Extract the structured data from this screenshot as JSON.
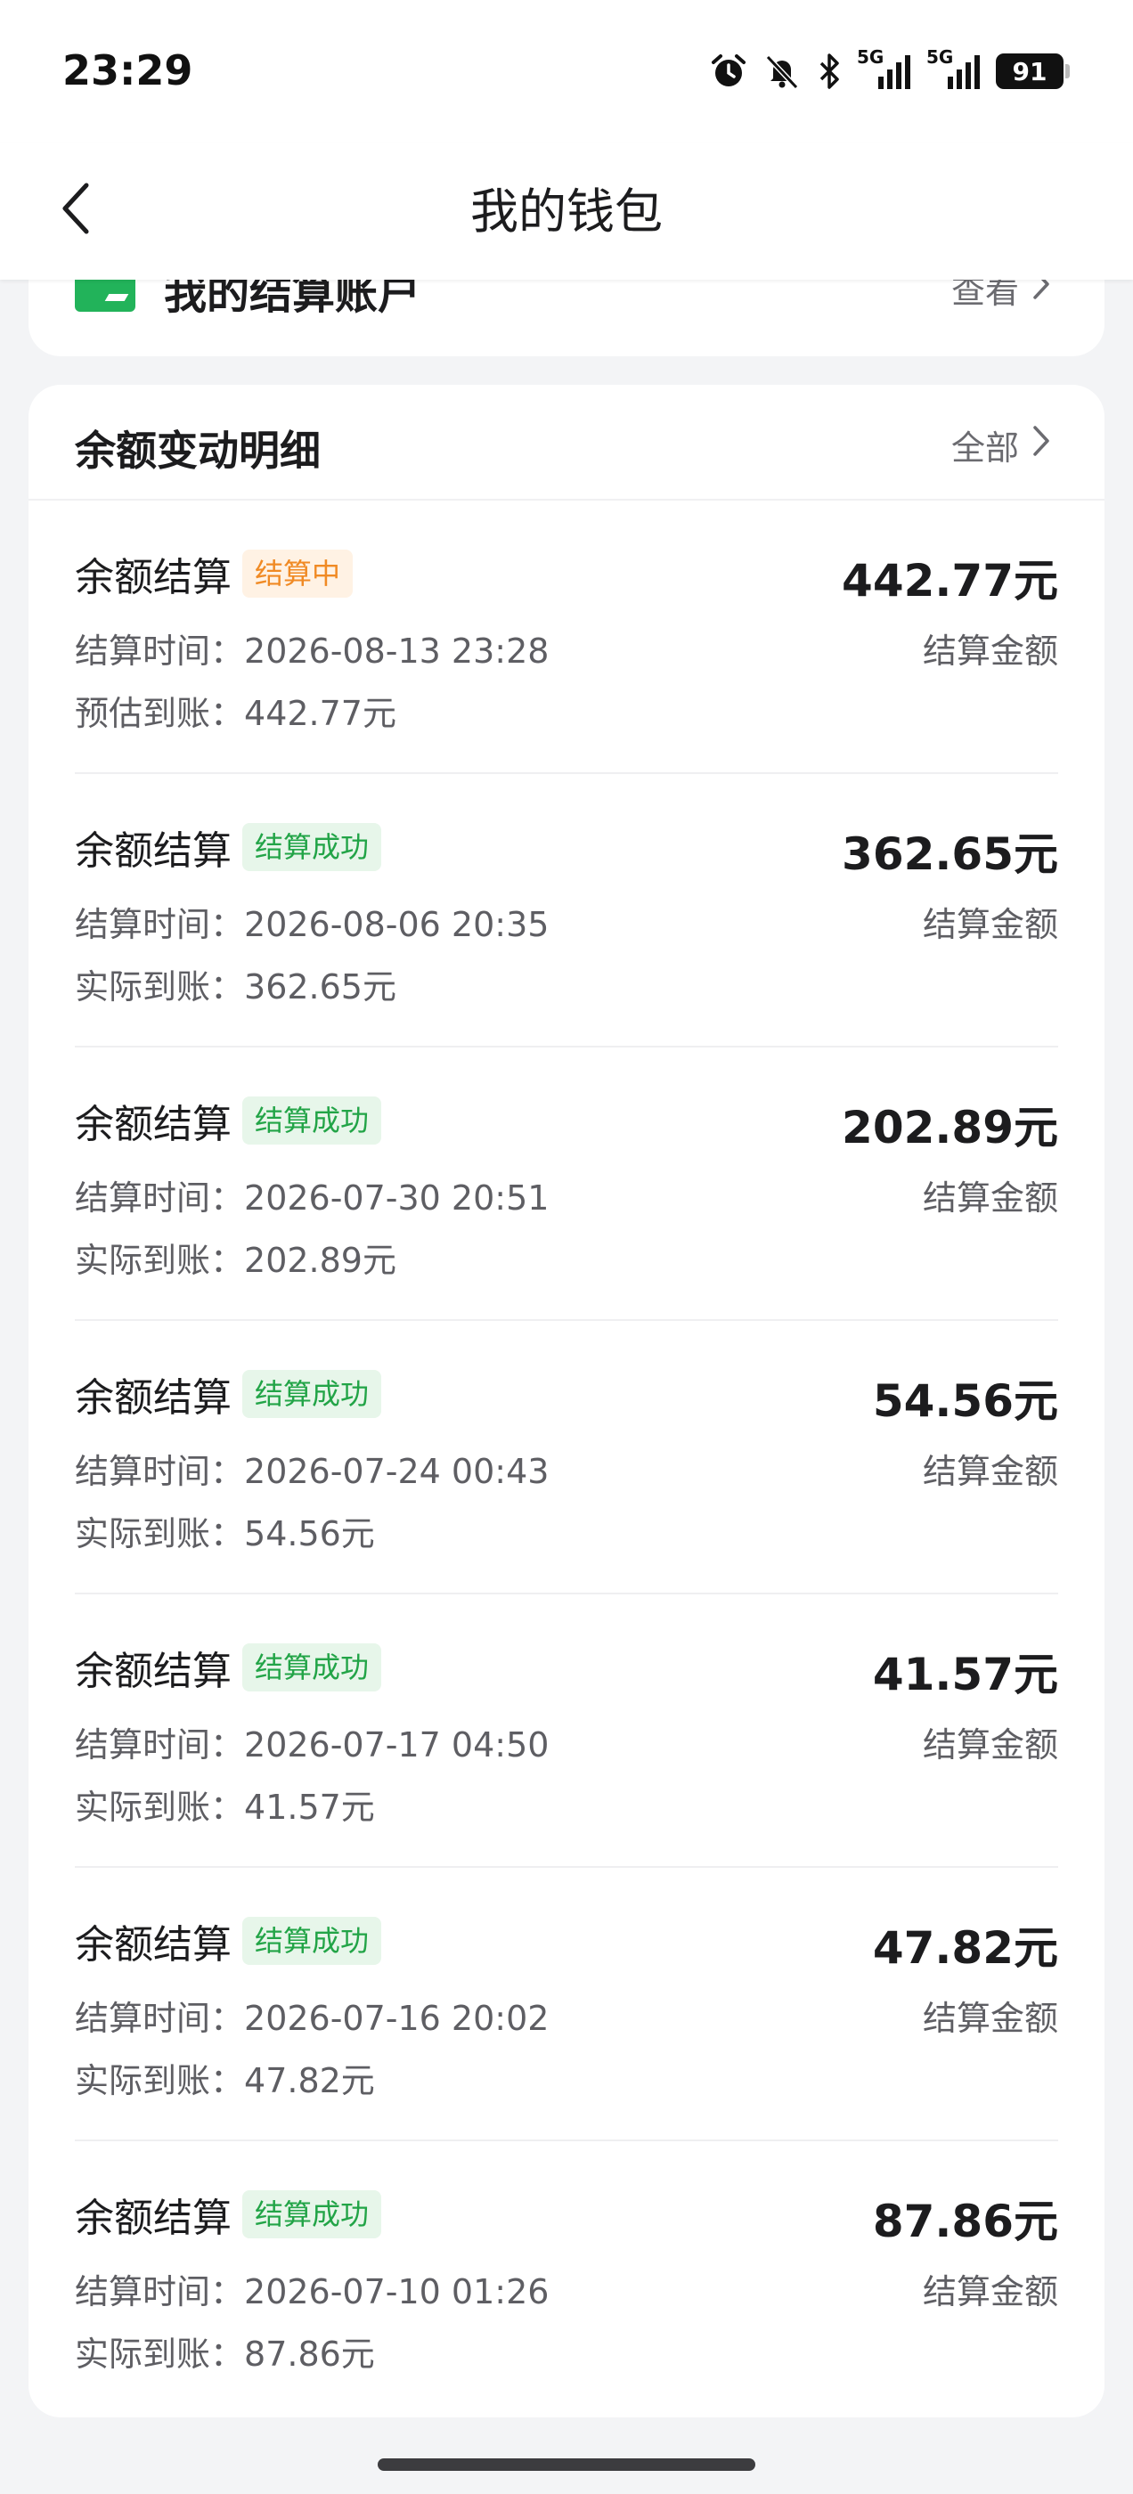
{
  "status_bar": {
    "time": "23:29",
    "signal_label_1": "5G",
    "signal_label_2": "5G",
    "battery": "91",
    "icons": [
      "alarm-icon",
      "bell-muted-icon",
      "bluetooth-icon",
      "signal-5g-icon",
      "signal-5g-icon",
      "battery-icon"
    ]
  },
  "nav": {
    "title": "我的钱包",
    "back_icon": "chevron-left-icon"
  },
  "account": {
    "label": "我的结算账户",
    "view_label": "查看"
  },
  "details": {
    "title": "余额变动明细",
    "all_label": "全部",
    "records": [
      {
        "title": "余额结算",
        "status": "结算中",
        "status_type": "pending",
        "time_label": "结算时间：",
        "time": "2026-08-13 23:28",
        "arrive_label": "预估到账：",
        "arrive": "442.77元",
        "amount": "442.77元",
        "amount_label": "结算金额"
      },
      {
        "title": "余额结算",
        "status": "结算成功",
        "status_type": "success",
        "time_label": "结算时间：",
        "time": "2026-08-06 20:35",
        "arrive_label": "实际到账：",
        "arrive": "362.65元",
        "amount": "362.65元",
        "amount_label": "结算金额"
      },
      {
        "title": "余额结算",
        "status": "结算成功",
        "status_type": "success",
        "time_label": "结算时间：",
        "time": "2026-07-30 20:51",
        "arrive_label": "实际到账：",
        "arrive": "202.89元",
        "amount": "202.89元",
        "amount_label": "结算金额"
      },
      {
        "title": "余额结算",
        "status": "结算成功",
        "status_type": "success",
        "time_label": "结算时间：",
        "time": "2026-07-24 00:43",
        "arrive_label": "实际到账：",
        "arrive": "54.56元",
        "amount": "54.56元",
        "amount_label": "结算金额"
      },
      {
        "title": "余额结算",
        "status": "结算成功",
        "status_type": "success",
        "time_label": "结算时间：",
        "time": "2026-07-17 04:50",
        "arrive_label": "实际到账：",
        "arrive": "41.57元",
        "amount": "41.57元",
        "amount_label": "结算金额"
      },
      {
        "title": "余额结算",
        "status": "结算成功",
        "status_type": "success",
        "time_label": "结算时间：",
        "time": "2026-07-16 20:02",
        "arrive_label": "实际到账：",
        "arrive": "47.82元",
        "amount": "47.82元",
        "amount_label": "结算金额"
      },
      {
        "title": "余额结算",
        "status": "结算成功",
        "status_type": "success",
        "time_label": "结算时间：",
        "time": "2026-07-10 01:26",
        "arrive_label": "实际到账：",
        "arrive": "87.86元",
        "amount": "87.86元",
        "amount_label": "结算金额"
      }
    ]
  },
  "colors": {
    "pending": "#f08a24",
    "success": "#22a447",
    "brand_green": "#22b35a"
  }
}
